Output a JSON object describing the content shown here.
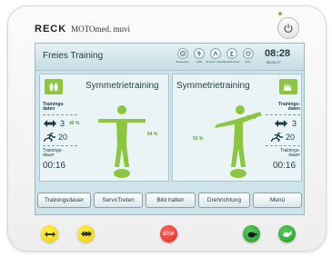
{
  "brand": {
    "logo": "RECK",
    "model": "MOTOmed. muvi"
  },
  "screen": {
    "title": "Freies Training",
    "status_icons": [
      {
        "name": "pedal-icon",
        "label": "Bedienpult"
      },
      {
        "name": "usb-icon",
        "label": "USB"
      },
      {
        "name": "bike-icon",
        "label": "Motorkr. halten"
      },
      {
        "name": "rotation-icon",
        "label": "Spastikschutz"
      },
      {
        "name": "heart-icon",
        "label": "ESH"
      }
    ],
    "clock": {
      "time": "08:28",
      "date": "06.06.17"
    }
  },
  "left_panel": {
    "title": "Symmetrietraining",
    "section_label": "Trainings- daten",
    "pct_stat": "46 %",
    "stat1_value": "3",
    "stat2_value": "20",
    "time_label": "Trainings- dauer",
    "time_value": "00:16",
    "balance_pct": "54 %"
  },
  "right_panel": {
    "title": "Symmetrietraining",
    "section_label": "Trainings- daten",
    "pct_stat": "45 %",
    "stat1_value": "3",
    "stat2_value": "20",
    "time_label": "Trainings- dauer",
    "time_value": "00:16",
    "balance_pct": "55 %"
  },
  "buttons": {
    "b1": "Trainingsdauer",
    "b2": "ServoTreten",
    "b3": "Bild halten",
    "b4": "Drehrichtung",
    "b5": "Menü"
  },
  "hardware": {
    "stop_label": "STOP"
  },
  "colors": {
    "accent_green": "#8cc63f",
    "pct_green": "#5da235",
    "screen_bg": "#cfe4ea"
  }
}
